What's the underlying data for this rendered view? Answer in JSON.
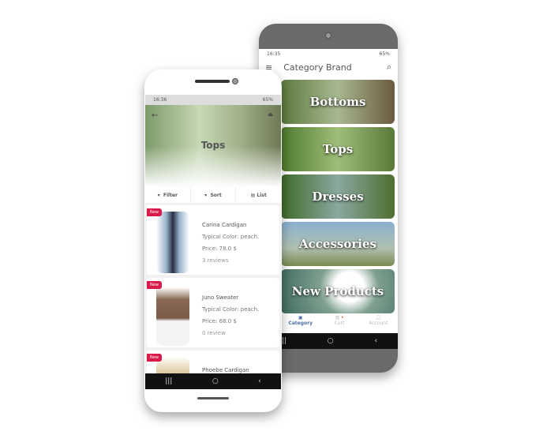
{
  "back_phone": {
    "status": {
      "time": "16:35",
      "battery": "65%"
    },
    "header": {
      "title": "Category Brand",
      "menu_icon": "hamburger-icon",
      "search_icon": "search-icon"
    },
    "categories": [
      {
        "label": "Bottoms"
      },
      {
        "label": "Tops"
      },
      {
        "label": "Dresses"
      },
      {
        "label": "Accessories"
      },
      {
        "label": "New Products"
      }
    ],
    "tabs": [
      {
        "label": "Category",
        "icon": "briefcase-icon",
        "active": true
      },
      {
        "label": "Cart",
        "icon": "cart-icon",
        "badge": true
      },
      {
        "label": "Account",
        "icon": "person-icon"
      }
    ]
  },
  "front_phone": {
    "status": {
      "time": "16:36",
      "battery": "65%"
    },
    "hero": {
      "title": "Tops"
    },
    "toolbar": {
      "filter": "Filter",
      "sort": "Sort",
      "list": "List"
    },
    "products": [
      {
        "badge": "New",
        "name": "Carina Cardigan",
        "color": "Typical Color: peach.",
        "price": "Price: 78.0 $",
        "reviews": "3 reviews"
      },
      {
        "badge": "New",
        "name": "Juno Sweater",
        "color": "Typical Color: peach.",
        "price": "Price: 68.0 $",
        "reviews": "0 review"
      },
      {
        "badge": "New",
        "name": "Phoebe Cardigan"
      }
    ]
  },
  "colors": {
    "accent": "#4a6fa5",
    "badge": "#d81b4a"
  }
}
